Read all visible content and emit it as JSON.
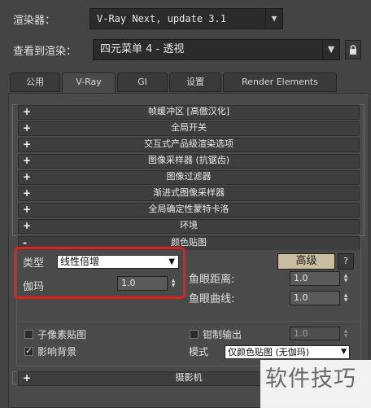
{
  "renderer": {
    "label": "渲染器：",
    "value": "V-Ray Next, update 3.1"
  },
  "view": {
    "label": "查看到渲染：",
    "value": "四元菜单 4 - 透视"
  },
  "tabs": [
    "公用",
    "V-Ray",
    "GI",
    "设置",
    "Render Elements"
  ],
  "active_tab": "V-Ray",
  "rollouts_top": [
    {
      "sign": "+",
      "title": "帧缓冲区 [高傲汉化]"
    },
    {
      "sign": "+",
      "title": "全局开关"
    },
    {
      "sign": "+",
      "title": "交互式产品级渲染选项"
    },
    {
      "sign": "+",
      "title": "图像采样器 (抗锯齿)"
    },
    {
      "sign": "+",
      "title": "图像过滤器"
    },
    {
      "sign": "+",
      "title": "渐进式图像采样器"
    },
    {
      "sign": "+",
      "title": "全局确定性蒙特卡洛"
    },
    {
      "sign": "+",
      "title": "环境"
    }
  ],
  "color_mapping": {
    "sign": "-",
    "title": "颜色贴图",
    "type_label": "类型",
    "type_value": "线性倍增",
    "gamma_label": "伽玛",
    "gamma_value": "1.0",
    "advanced_button": "高级",
    "help_button": "?",
    "fisheye_dist_label": "鱼眼距离:",
    "fisheye_dist_value": "1.0",
    "fisheye_curve_label": "鱼眼曲线:",
    "fisheye_curve_value": "1.0",
    "subpixel_label": "子像素贴图",
    "subpixel_checked": false,
    "clamp_label": "钳制输出",
    "clamp_checked": false,
    "clamp_value": "1.0",
    "affect_bg_label": "影响背景",
    "affect_bg_checked": true,
    "mode_label": "模式",
    "mode_value": "仅颜色贴图 (无伽玛)"
  },
  "rollouts_bottom": [
    {
      "sign": "+",
      "title": "摄影机"
    }
  ],
  "watermark": "软件技巧",
  "colors": {
    "highlight": "#e0201c",
    "advanced_button": "#c9bda0"
  }
}
